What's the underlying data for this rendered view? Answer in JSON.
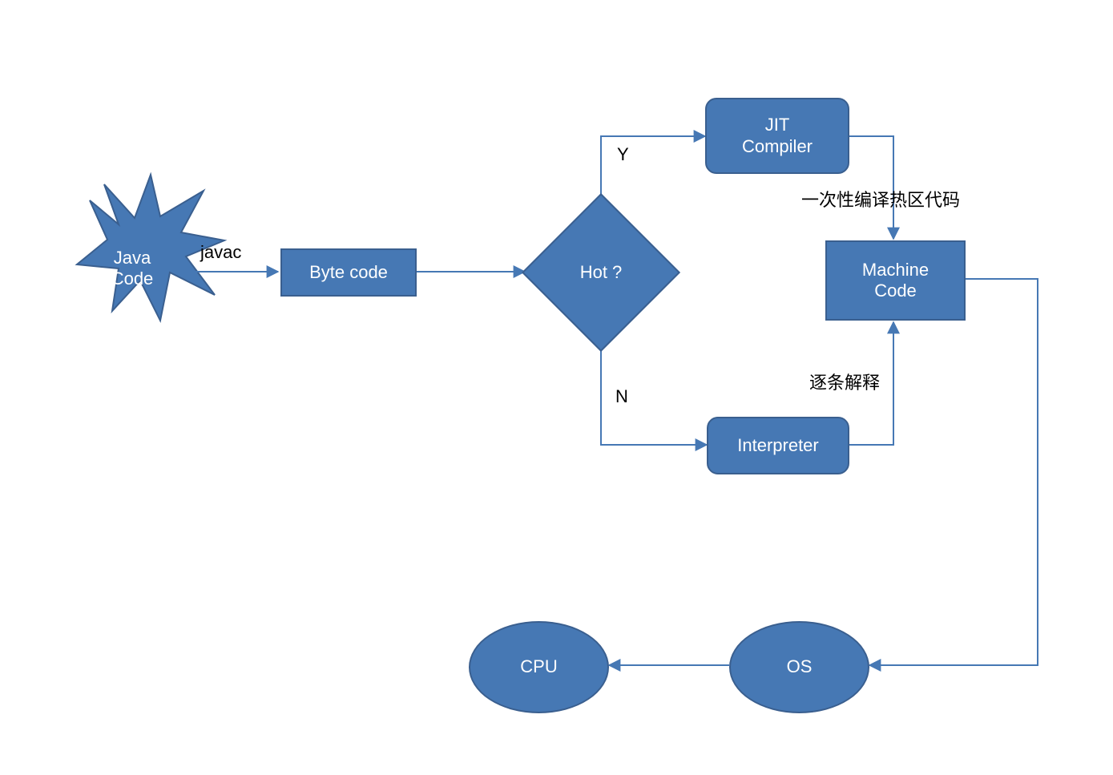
{
  "nodes": {
    "java_code": "Java\nCode",
    "byte_code": "Byte code",
    "hot": "Hot ?",
    "jit": "JIT\nCompiler",
    "interpreter": "Interpreter",
    "machine_code": "Machine\nCode",
    "os": "OS",
    "cpu": "CPU"
  },
  "edges": {
    "javac": "javac",
    "yes": "Y",
    "no": "N",
    "jit_note": "一次性编译热区代码",
    "interp_note": "逐条解释"
  },
  "colors": {
    "fill": "#4678b4",
    "stroke": "#3a5f8f",
    "line": "#4678b4"
  }
}
